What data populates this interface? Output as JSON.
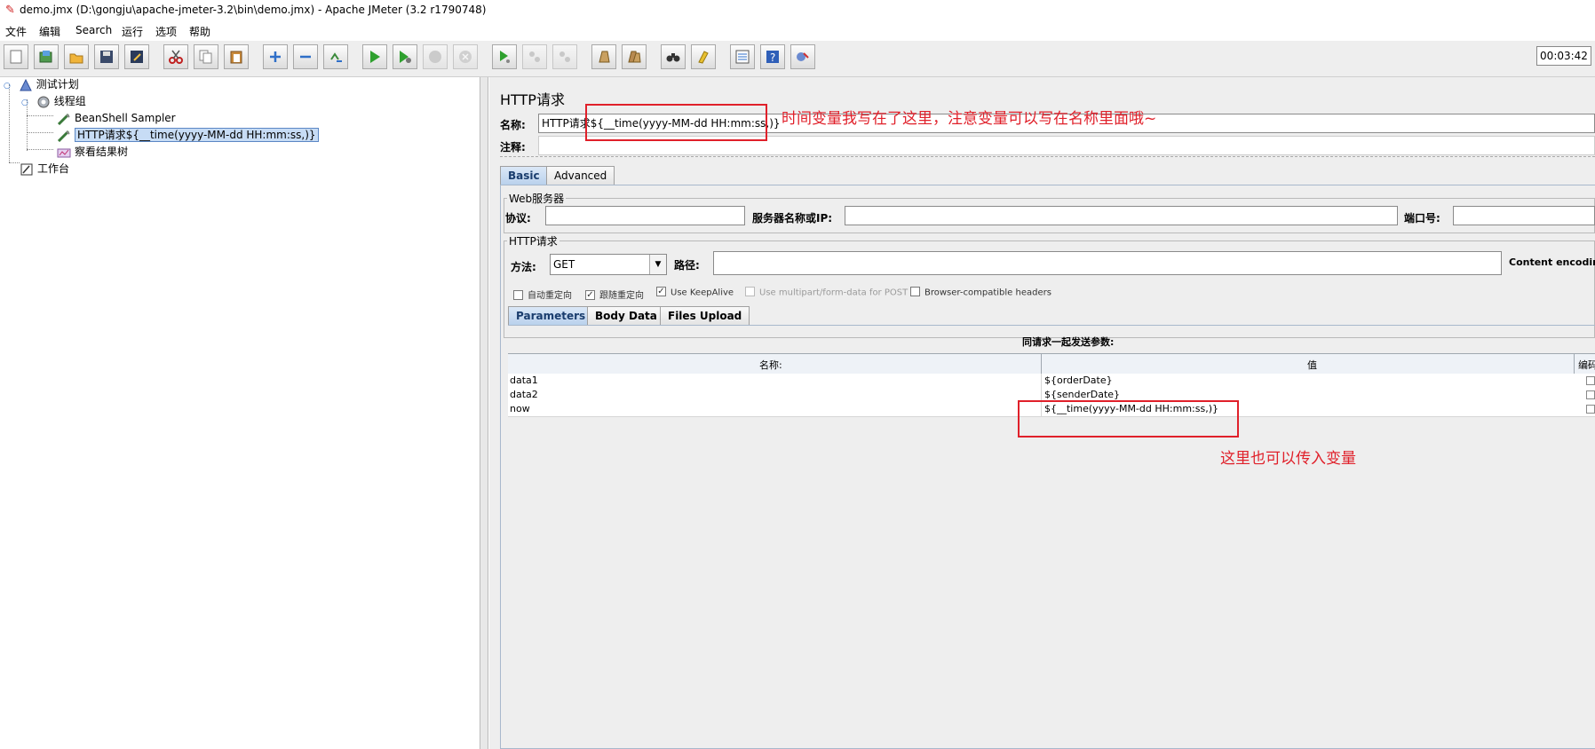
{
  "window": {
    "title": "demo.jmx (D:\\gongju\\apache-jmeter-3.2\\bin\\demo.jmx) - Apache JMeter (3.2 r1790748)"
  },
  "menu": [
    "文件",
    "编辑",
    "Search",
    "运行",
    "选项",
    "帮助"
  ],
  "toolbar": {
    "timer": "00:03:42",
    "icons": [
      "new-icon",
      "templates-icon",
      "open-icon",
      "save-icon",
      "save-as-icon",
      "cut-icon",
      "copy-icon",
      "paste-icon",
      "expand-icon",
      "collapse-icon",
      "toggle-icon",
      "start-icon",
      "start-no-pause-icon",
      "stop-icon",
      "shutdown-icon",
      "remote-start-icon",
      "remote-stop-icon",
      "remote-exit-icon",
      "clear-icon",
      "clear-all-icon",
      "search-icon",
      "reset-search-icon",
      "function-helper-icon",
      "help-icon",
      "log-viewer-icon"
    ]
  },
  "tree": {
    "nodes": [
      {
        "label": "测试计划",
        "icon": "test-plan-icon"
      },
      {
        "label": "线程组",
        "icon": "thread-group-icon"
      },
      {
        "label": "BeanShell Sampler",
        "icon": "sampler-icon"
      },
      {
        "label": "HTTP请求${__time(yyyy-MM-dd HH:mm:ss,)}",
        "icon": "sampler-icon",
        "selected": true
      },
      {
        "label": "察看结果树",
        "icon": "listener-icon"
      },
      {
        "label": "工作台",
        "icon": "workbench-icon"
      }
    ]
  },
  "panel": {
    "heading": "HTTP请求",
    "name_label": "名称:",
    "name_value": "HTTP请求${__time(yyyy-MM-dd HH:mm:ss,)}",
    "comment_label": "注释:",
    "tabs": [
      "Basic",
      "Advanced"
    ],
    "web_server": {
      "group_label": "Web服务器",
      "protocol_label": "协议:",
      "server_label": "服务器名称或IP:",
      "port_label": "端口号:"
    },
    "http_request": {
      "group_label": "HTTP请求",
      "method_label": "方法:",
      "method_value": "GET",
      "path_label": "路径:",
      "encoding_label": "Content encoding"
    },
    "options": [
      {
        "label": "自动重定向",
        "checked": false,
        "enabled": true
      },
      {
        "label": "跟随重定向",
        "checked": true,
        "enabled": true
      },
      {
        "label": "Use KeepAlive",
        "checked": true,
        "enabled": true
      },
      {
        "label": "Use multipart/form-data for POST",
        "checked": false,
        "enabled": false
      },
      {
        "label": "Browser-compatible headers",
        "checked": false,
        "enabled": true
      }
    ],
    "sub_tabs": [
      "Parameters",
      "Body Data",
      "Files Upload"
    ],
    "params": {
      "caption": "同请求一起发送参数:",
      "columns": [
        "名称:",
        "值",
        "编码"
      ],
      "rows": [
        {
          "name": "data1",
          "value": "${orderDate}"
        },
        {
          "name": "data2",
          "value": "${senderDate}"
        },
        {
          "name": "now",
          "value": "${__time(yyyy-MM-dd HH:mm:ss,)}"
        }
      ]
    }
  },
  "annotations": {
    "top": "时间变量我写在了这里，注意变量可以写在名称里面哦~",
    "bottom": "这里也可以传入变量"
  },
  "colors": {
    "annotation": "#e0202a",
    "selection": "#c7dcf5",
    "panel_bg": "#eeeeee"
  }
}
